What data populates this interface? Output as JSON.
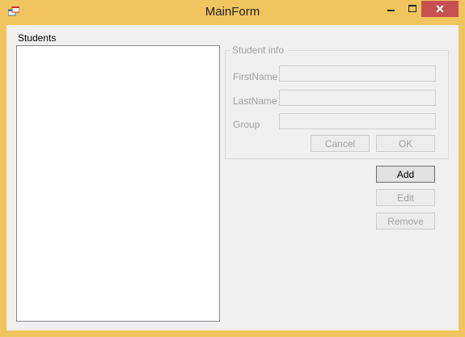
{
  "window": {
    "title": "MainForm",
    "close_glyph": "✕",
    "icon": "app-icon"
  },
  "students": {
    "label": "Students",
    "items": []
  },
  "student_info": {
    "title": "Student info",
    "firstname_label": "FirstName",
    "lastname_label": "LastName",
    "group_label": "Group",
    "firstname_value": "",
    "lastname_value": "",
    "group_value": "",
    "cancel_label": "Cancel",
    "ok_label": "OK"
  },
  "actions": {
    "add_label": "Add",
    "edit_label": "Edit",
    "remove_label": "Remove"
  },
  "colors": {
    "title_bar": "#f0c45e",
    "close_button": "#c75050",
    "disabled_text": "#a0a0a0"
  }
}
